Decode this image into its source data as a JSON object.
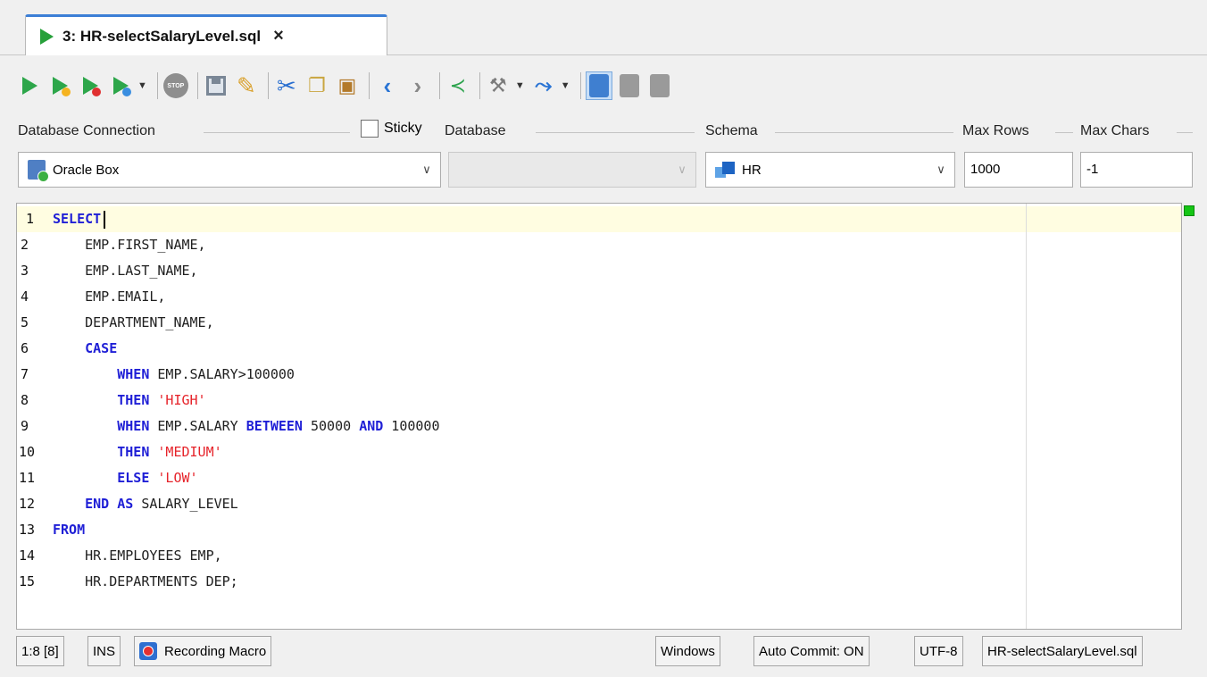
{
  "tab": {
    "title": "3: HR-selectSalaryLevel.sql",
    "close": "×"
  },
  "toolbar": {
    "icons": [
      "run-icon",
      "run-current-icon",
      "run-script-icon",
      "run-explain-icon",
      "stop-icon",
      "save-icon",
      "save-as-icon",
      "cut-icon",
      "copy-icon",
      "paste-icon",
      "back-icon",
      "forward-icon",
      "share-icon",
      "tools-icon",
      "jump-icon",
      "results-panel-icon",
      "split-icon",
      "panel-icon"
    ]
  },
  "connection": {
    "db_connection_label": "Database Connection",
    "db_connection_value": "Oracle Box",
    "sticky_label": "Sticky",
    "database_label": "Database",
    "database_value": "",
    "schema_label": "Schema",
    "schema_value": "HR",
    "max_rows_label": "Max Rows",
    "max_rows_value": "1000",
    "max_chars_label": "Max Chars",
    "max_chars_value": "-1"
  },
  "editor": {
    "line_numbers": [
      "1",
      "2",
      "3",
      "4",
      "5",
      "6",
      "7",
      "8",
      "9",
      "10",
      "11",
      "12",
      "13",
      "14",
      "15"
    ],
    "lines": [
      [
        {
          "t": "SELECT",
          "k": "kw"
        }
      ],
      [
        {
          "t": "    EMP.FIRST_NAME,"
        }
      ],
      [
        {
          "t": "    EMP.LAST_NAME,"
        }
      ],
      [
        {
          "t": "    EMP.EMAIL,"
        }
      ],
      [
        {
          "t": "    DEPARTMENT_NAME,"
        }
      ],
      [
        {
          "t": "    "
        },
        {
          "t": "CASE",
          "k": "kw"
        }
      ],
      [
        {
          "t": "        "
        },
        {
          "t": "WHEN",
          "k": "kw"
        },
        {
          "t": " EMP.SALARY>100000"
        }
      ],
      [
        {
          "t": "        "
        },
        {
          "t": "THEN",
          "k": "kw"
        },
        {
          "t": " "
        },
        {
          "t": "'HIGH'",
          "k": "str"
        }
      ],
      [
        {
          "t": "        "
        },
        {
          "t": "WHEN",
          "k": "kw"
        },
        {
          "t": " EMP.SALARY "
        },
        {
          "t": "BETWEEN",
          "k": "kw"
        },
        {
          "t": " 50000 "
        },
        {
          "t": "AND",
          "k": "kw"
        },
        {
          "t": " 100000"
        }
      ],
      [
        {
          "t": "        "
        },
        {
          "t": "THEN",
          "k": "kw"
        },
        {
          "t": " "
        },
        {
          "t": "'MEDIUM'",
          "k": "str"
        }
      ],
      [
        {
          "t": "        "
        },
        {
          "t": "ELSE",
          "k": "kw"
        },
        {
          "t": " "
        },
        {
          "t": "'LOW'",
          "k": "str"
        }
      ],
      [
        {
          "t": "    "
        },
        {
          "t": "END",
          "k": "kw"
        },
        {
          "t": " "
        },
        {
          "t": "AS",
          "k": "kw"
        },
        {
          "t": " SALARY_LEVEL"
        }
      ],
      [
        {
          "t": "FROM",
          "k": "kw"
        }
      ],
      [
        {
          "t": "    HR.EMPLOYEES EMP,"
        }
      ],
      [
        {
          "t": "    HR.DEPARTMENTS DEP;"
        }
      ]
    ]
  },
  "status": {
    "position": "1:8 [8]",
    "mode": "INS",
    "macro": "Recording Macro",
    "line_endings": "Windows",
    "auto_commit": "Auto Commit: ON",
    "encoding": "UTF-8",
    "file": "HR-selectSalaryLevel.sql"
  },
  "colors": {
    "keyword": "#1f1fd6",
    "string": "#e6232a",
    "current_line": "#fffde1",
    "accent": "#3c7fd6"
  }
}
